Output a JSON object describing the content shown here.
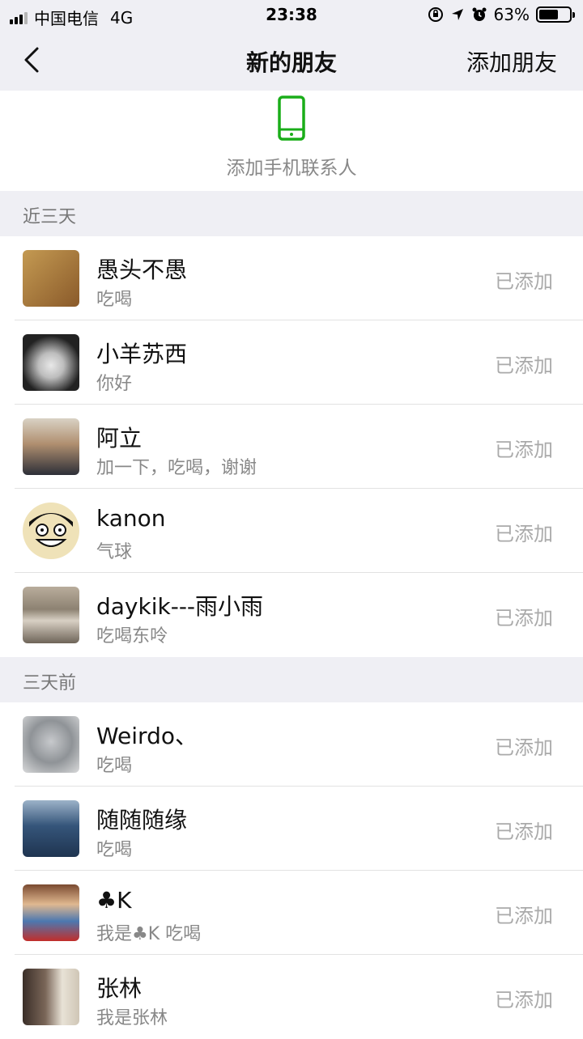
{
  "status_bar": {
    "carrier": "中国电信",
    "network": "4G",
    "time": "23:38",
    "battery_percent": "63%",
    "battery_level": 0.63
  },
  "nav": {
    "back_icon": "chevron-left-icon",
    "title": "新的朋友",
    "action": "添加朋友"
  },
  "add_phone": {
    "icon": "mobile-phone-icon",
    "icon_color": "#1aad19",
    "label": "添加手机联系人"
  },
  "sections": [
    {
      "title": "近三天",
      "items": [
        {
          "name": "愚头不愚",
          "message": "吃喝",
          "status": "已添加",
          "avatar_color": "#c8a060"
        },
        {
          "name": "小羊苏西",
          "message": "你好",
          "status": "已添加",
          "avatar_color": "#6d6d6d"
        },
        {
          "name": "阿立",
          "message": "加一下，吃喝，谢谢",
          "status": "已添加",
          "avatar_color": "#8a6d55"
        },
        {
          "name": "kanon",
          "message": "气球",
          "status": "已添加",
          "avatar_color": "#e9d8a6"
        },
        {
          "name": "daykik---雨小雨",
          "message": "吃喝东呤",
          "status": "已添加",
          "avatar_color": "#9b8f80"
        }
      ]
    },
    {
      "title": "三天前",
      "items": [
        {
          "name": "Weirdo、",
          "message": "吃喝",
          "status": "已添加",
          "avatar_color": "#9aa0a6"
        },
        {
          "name": "随随随缘",
          "message": "吃喝",
          "status": "已添加",
          "avatar_color": "#4a6b8c"
        },
        {
          "name": "♣K",
          "message": "我是♣K 吃喝",
          "status": "已添加",
          "avatar_color": "#c43a32"
        },
        {
          "name": "张林",
          "message": "我是张林",
          "status": "已添加",
          "avatar_color": "#5a4a40"
        }
      ]
    }
  ]
}
